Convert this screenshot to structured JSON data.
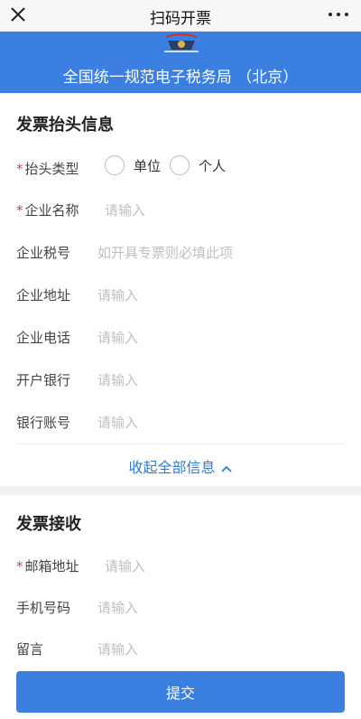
{
  "topbar": {
    "title": "扫码开票"
  },
  "banner": {
    "org_name": "全国统一规范电子税务局 （北京）"
  },
  "header_section": {
    "title": "发票抬头信息",
    "type_label": "抬头类型",
    "type_options": [
      "单位",
      "个人"
    ],
    "fields": [
      {
        "label": "企业名称",
        "placeholder": "请输入",
        "required": true
      },
      {
        "label": "企业税号",
        "placeholder": "如开具专票则必填此项",
        "required": false
      },
      {
        "label": "企业地址",
        "placeholder": "请输入",
        "required": false
      },
      {
        "label": "企业电话",
        "placeholder": "请输入",
        "required": false
      },
      {
        "label": "开户银行",
        "placeholder": "请输入",
        "required": false
      },
      {
        "label": "银行账号",
        "placeholder": "请输入",
        "required": false
      }
    ],
    "collapse_label": "收起全部信息"
  },
  "receive_section": {
    "title": "发票接收",
    "fields": [
      {
        "label": "邮箱地址",
        "placeholder": "请输入",
        "required": true
      },
      {
        "label": "手机号码",
        "placeholder": "请输入",
        "required": false
      },
      {
        "label": "留言",
        "placeholder": "请输入",
        "required": false
      }
    ]
  },
  "footer": {
    "submit_label": "提交"
  },
  "colors": {
    "accent": "#3b7fe0",
    "required": "#e4393c",
    "link": "#2f7bd6"
  }
}
